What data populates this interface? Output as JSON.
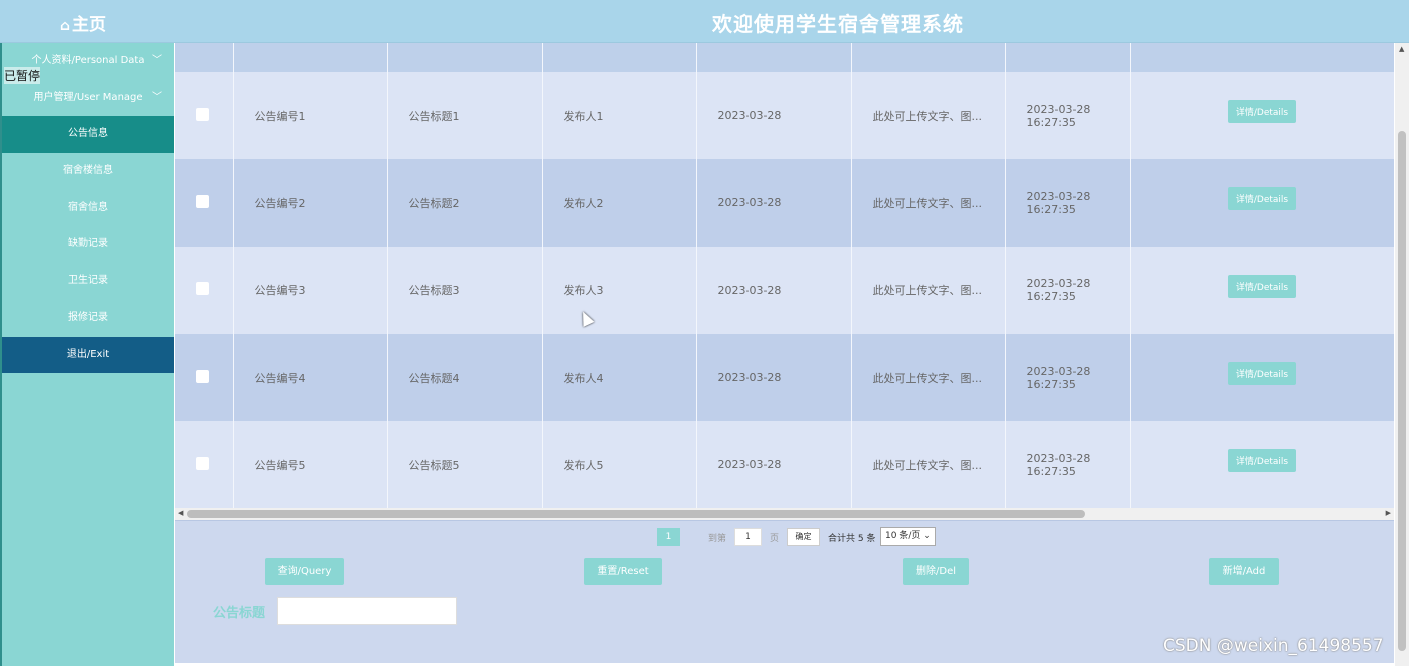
{
  "header": {
    "home_icon": "home-icon",
    "home_label": "主页",
    "title": "欢迎使用学生宿舍管理系统"
  },
  "overlay": {
    "paused_label": "已暂停"
  },
  "sidebar": {
    "items": [
      {
        "label": "个人资料/Personal Data",
        "has_chevron": true
      },
      {
        "label": "用户管理/User Manage",
        "has_chevron": true
      },
      {
        "label": "公告信息",
        "active": true
      },
      {
        "label": "宿舍楼信息"
      },
      {
        "label": "宿舍信息"
      },
      {
        "label": "缺勤记录"
      },
      {
        "label": "卫生记录"
      },
      {
        "label": "报修记录"
      },
      {
        "label": "退出/Exit"
      }
    ]
  },
  "table": {
    "headers": [
      "",
      "",
      "",
      "",
      "",
      "",
      "",
      ""
    ],
    "rows": [
      {
        "code": "公告编号1",
        "title": "公告标题1",
        "publisher": "发布人1",
        "date": "2023-03-28",
        "content": "此处可上传文字、图...",
        "time": "2023-03-28 16:27:35",
        "action": "详情/Details"
      },
      {
        "code": "公告编号2",
        "title": "公告标题2",
        "publisher": "发布人2",
        "date": "2023-03-28",
        "content": "此处可上传文字、图...",
        "time": "2023-03-28 16:27:35",
        "action": "详情/Details"
      },
      {
        "code": "公告编号3",
        "title": "公告标题3",
        "publisher": "发布人3",
        "date": "2023-03-28",
        "content": "此处可上传文字、图...",
        "time": "2023-03-28 16:27:35",
        "action": "详情/Details"
      },
      {
        "code": "公告编号4",
        "title": "公告标题4",
        "publisher": "发布人4",
        "date": "2023-03-28",
        "content": "此处可上传文字、图...",
        "time": "2023-03-28 16:27:35",
        "action": "详情/Details"
      },
      {
        "code": "公告编号5",
        "title": "公告标题5",
        "publisher": "发布人5",
        "date": "2023-03-28",
        "content": "此处可上传文字、图...",
        "time": "2023-03-28 16:27:35",
        "action": "详情/Details"
      }
    ]
  },
  "pagination": {
    "current_page": "1",
    "goto_label": "到第",
    "goto_value": "1",
    "page_unit": "页",
    "confirm_label": "确定",
    "total_label": "合计共 5 条",
    "page_size": "10 条/页"
  },
  "search": {
    "query_label": "查询/Query",
    "reset_label": "重置/Reset",
    "delete_label": "删除/Del",
    "add_label": "新增/Add",
    "field_label": "公告标题",
    "field_value": ""
  },
  "watermark": "CSDN @weixin_61498557",
  "colors": {
    "accent": "#8ad6d3",
    "header_bg": "#a9d5ea",
    "active_item": "#178d89",
    "exit_item": "#135d87",
    "row_light": "#dce4f5",
    "row_dark": "#bfcfea"
  }
}
